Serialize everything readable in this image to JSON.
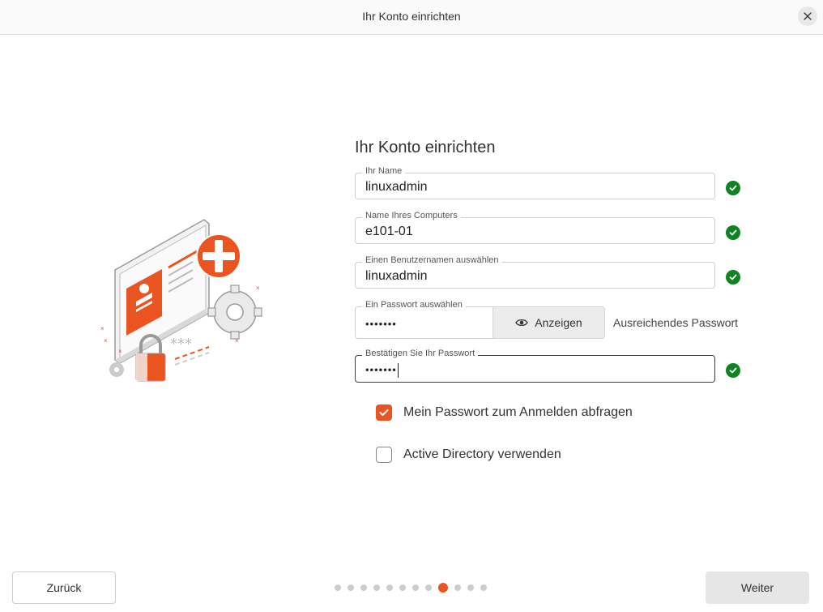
{
  "window": {
    "title": "Ihr Konto einrichten"
  },
  "form": {
    "heading": "Ihr Konto einrichten",
    "name": {
      "label": "Ihr Name",
      "value": "linuxadmin"
    },
    "computer": {
      "label": "Name Ihres Computers",
      "value": "e101-01"
    },
    "username": {
      "label": "Einen Benutzernamen auswählen",
      "value": "linuxadmin"
    },
    "password": {
      "label": "Ein Passwort auswählen",
      "value": "•••••••",
      "show_label": "Anzeigen",
      "strength": "Ausreichendes Passwort"
    },
    "confirm": {
      "label": "Bestätigen Sie Ihr Passwort",
      "value": "•••••••"
    },
    "ask_password": {
      "label": "Mein Passwort zum Anmelden abfragen",
      "checked": true
    },
    "active_directory": {
      "label": "Active Directory verwenden",
      "checked": false
    }
  },
  "nav": {
    "back_label": "Zurück",
    "next_label": "Weiter",
    "steps_total": 12,
    "current_step": 9
  },
  "colors": {
    "accent": "#e95420",
    "success": "#0e8420"
  }
}
